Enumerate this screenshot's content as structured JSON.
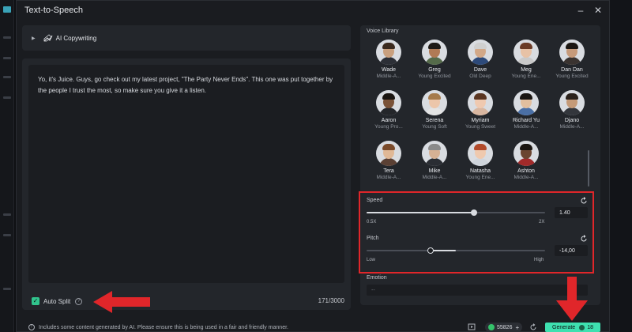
{
  "window": {
    "title": "Text-to-Speech",
    "minimize": "–",
    "close": "✕"
  },
  "copywriting": {
    "label": "AI Copywriting"
  },
  "editor": {
    "text": "Yo, it's Juice. Guys, go check out my latest project, \"The Party Never Ends\".  This one was put together by the people I trust the most, so make sure you give it a listen.",
    "auto_split_label": "Auto Split",
    "counter": "171/3000"
  },
  "library": {
    "title": "Voice Library",
    "voices": [
      {
        "name": "Wade",
        "desc": "Middle-A...",
        "skin": "#c9a07e",
        "hair": "#3b2a1e",
        "shirt": "#2c2f36"
      },
      {
        "name": "Greg",
        "desc": "Young Excited",
        "skin": "#b07a55",
        "hair": "#1e1a16",
        "shirt": "#556b4a"
      },
      {
        "name": "Dave",
        "desc": "Old Deep",
        "skin": "#d2a888",
        "hair": "#cfcfcf",
        "shirt": "#2d4a7a"
      },
      {
        "name": "Meg",
        "desc": "Young Ene...",
        "skin": "#e7c2a6",
        "hair": "#6b3b26",
        "shirt": "#c9c9c9"
      },
      {
        "name": "Dan Dan",
        "desc": "Young Excited",
        "skin": "#c69a7a",
        "hair": "#1a1511",
        "shirt": "#3a3330"
      },
      {
        "name": "Aaron",
        "desc": "Young Pro...",
        "skin": "#7a5238",
        "hair": "#1a1511",
        "shirt": "#24262a"
      },
      {
        "name": "Serena",
        "desc": "Young Soft",
        "skin": "#ecc6aa",
        "hair": "#a57a4b",
        "shirt": "#e4e4e4"
      },
      {
        "name": "Myriam",
        "desc": "Young Sweet",
        "skin": "#efc9b0",
        "hair": "#5a3520",
        "shirt": "#d8b6a0"
      },
      {
        "name": "Richard Yu",
        "desc": "Middle-A...",
        "skin": "#e2bf9f",
        "hair": "#1a1511",
        "shirt": "#4a6fa5"
      },
      {
        "name": "Djano",
        "desc": "Middle-A...",
        "skin": "#c49a78",
        "hair": "#2a211b",
        "shirt": "#33363c"
      },
      {
        "name": "Tera",
        "desc": "Middle-A...",
        "skin": "#e0b896",
        "hair": "#7a4a2a",
        "shirt": "#5a4034"
      },
      {
        "name": "Mike",
        "desc": "Middle-A...",
        "skin": "#d6b194",
        "hair": "#8a8a8a",
        "shirt": "#2a2d33"
      },
      {
        "name": "Natasha",
        "desc": "Young Ene...",
        "skin": "#efc9ae",
        "hair": "#b24a2a",
        "shirt": "#cfd5dc"
      },
      {
        "name": "Ashton",
        "desc": "Middle-A...",
        "skin": "#6b4530",
        "hair": "#1a1511",
        "shirt": "#a12a2a"
      }
    ]
  },
  "speed": {
    "label": "Speed",
    "value": "1.40",
    "min_label": "0.5X",
    "max_label": "2X",
    "level": 0.6
  },
  "pitch": {
    "label": "Pitch",
    "value": "-14,00",
    "min_label": "Low",
    "max_label": "High",
    "level": 0.36
  },
  "emotion": {
    "label": "Emotion",
    "value": "--"
  },
  "footer": {
    "notice": "Includes some content generated by AI. Please ensure this is being used in a fair and friendly manner.",
    "credits": "55826",
    "generate_label": "Generate",
    "generate_cost": "18"
  },
  "colors": {
    "accent": "#3ee0b0",
    "highlight_box": "#e0262a",
    "arrow": "#e0262a",
    "check": "#31c48d"
  }
}
